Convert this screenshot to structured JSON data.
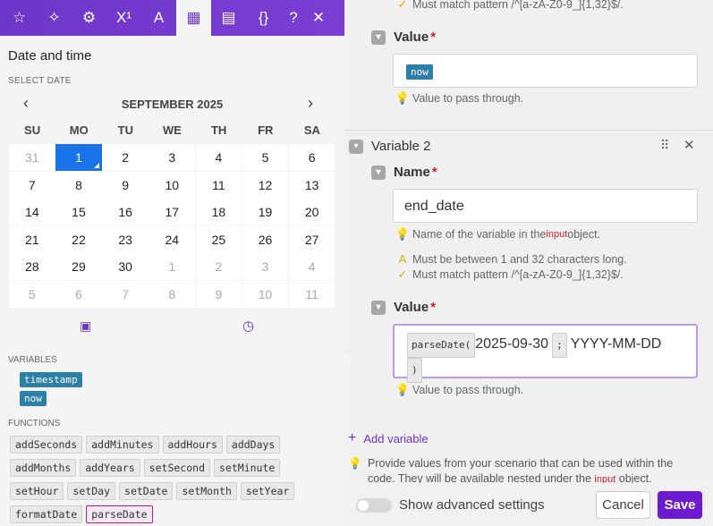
{
  "top_rule": {
    "text": "Must match pattern /^[a-zA-Z0-9_]{1,32}$/."
  },
  "var1_value": {
    "label": "Value",
    "pill": "now",
    "hint": "Value to pass through."
  },
  "variable2": {
    "title": "Variable 2",
    "name_label": "Name",
    "name_value": "end_date",
    "name_hint_prefix": "Name of the variable in the ",
    "name_hint_code": "input",
    "name_hint_suffix": " object.",
    "rule1": "Must be between 1 and 32 characters long.",
    "rule2": "Must match pattern /^[a-zA-Z0-9_]{1,32}$/.",
    "value_label": "Value",
    "fn_open": "parseDate(",
    "arg1": "2025-09-30",
    "sep": ";",
    "arg2": "YYYY-MM-DD",
    "fn_close": ")",
    "value_hint": "Value to pass through."
  },
  "add_variable": "Add variable",
  "provide_text_1": "Provide values from your scenario that can be used within the",
  "provide_text_2": "code. They will be available nested under the ",
  "provide_text_code": "input",
  "provide_text_3": " object.",
  "advanced_label": "Show advanced settings",
  "cancel_label": "Cancel",
  "save_label": "Save",
  "panel": {
    "title": "Date and time",
    "select_date": "SELECT DATE",
    "month": "SEPTEMBER 2025",
    "weekdays": [
      "SU",
      "MO",
      "TU",
      "WE",
      "TH",
      "FR",
      "SA"
    ],
    "weeks": [
      [
        "31",
        "1",
        "2",
        "3",
        "4",
        "5",
        "6"
      ],
      [
        "7",
        "8",
        "9",
        "10",
        "11",
        "12",
        "13"
      ],
      [
        "14",
        "15",
        "16",
        "17",
        "18",
        "19",
        "20"
      ],
      [
        "21",
        "22",
        "23",
        "24",
        "25",
        "26",
        "27"
      ],
      [
        "28",
        "29",
        "30",
        "1",
        "2",
        "3",
        "4"
      ],
      [
        "5",
        "6",
        "7",
        "8",
        "9",
        "10",
        "11"
      ]
    ],
    "variables_label": "VARIABLES",
    "variables": [
      "timestamp",
      "now"
    ],
    "functions_label": "FUNCTIONS",
    "functions": [
      "addSeconds",
      "addMinutes",
      "addHours",
      "addDays",
      "addMonths",
      "addYears",
      "setSecond",
      "setMinute",
      "setHour",
      "setDay",
      "setDate",
      "setMonth",
      "setYear",
      "formatDate",
      "parseDate"
    ],
    "tabs": [
      "star-icon",
      "sparkle-icon",
      "gear-icon",
      "superscript-icon",
      "text-icon",
      "calendar-icon",
      "table-icon",
      "braces-icon",
      "help-icon",
      "close-icon"
    ],
    "tab_glyphs": [
      "☆",
      "✧",
      "⚙",
      "X¹",
      "A",
      "▦",
      "▤",
      "{}",
      "?",
      "✕"
    ]
  },
  "colors": {
    "accent": "#6d36c9",
    "selected_day": "#1a73e8",
    "pill": "#2c7fa6",
    "highlight": "#c2187a"
  }
}
